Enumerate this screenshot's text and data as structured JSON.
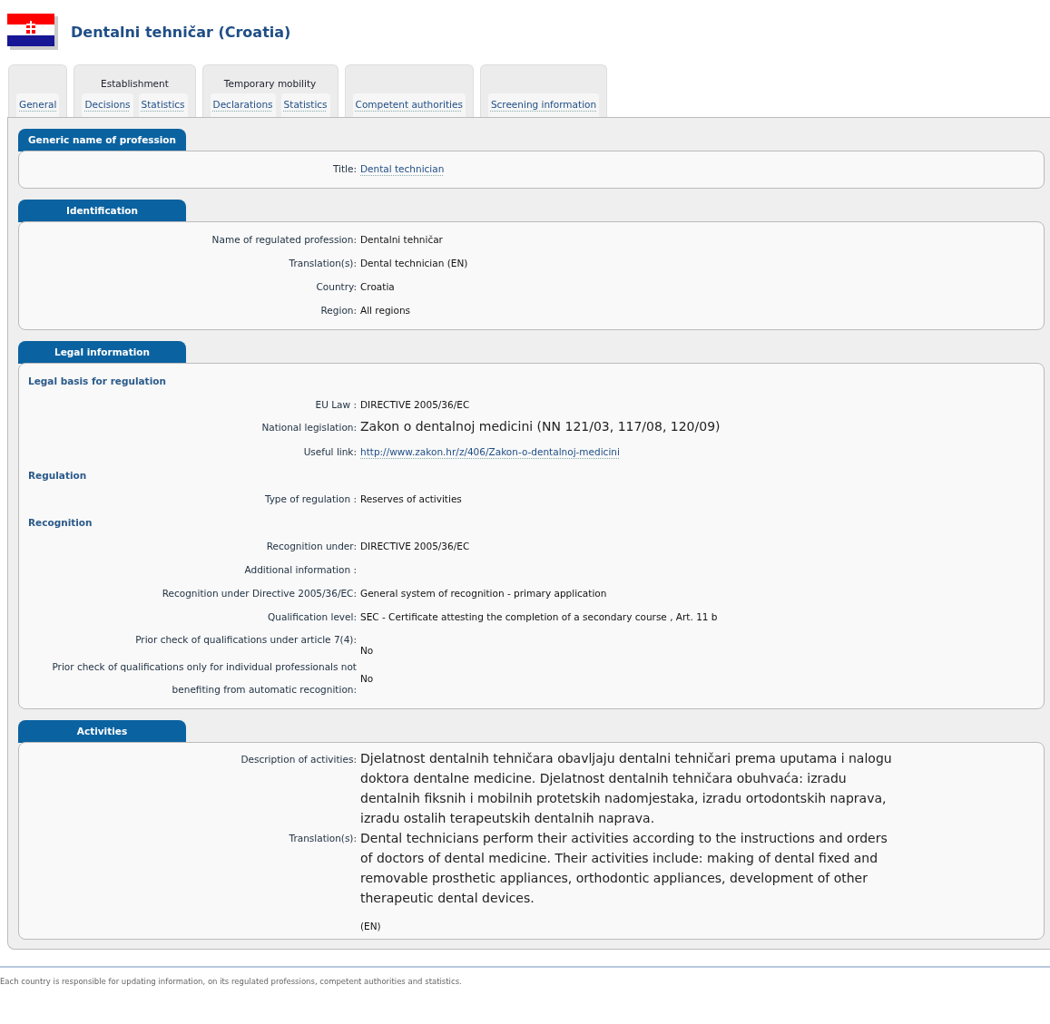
{
  "header": {
    "title": "Dentalni tehničar (Croatia)"
  },
  "tab_groups": [
    {
      "tabs": [
        {
          "label": "General"
        }
      ]
    },
    {
      "title": "Establishment",
      "tabs": [
        {
          "label": "Decisions"
        },
        {
          "label": "Statistics"
        }
      ]
    },
    {
      "title": "Temporary mobility",
      "tabs": [
        {
          "label": "Declarations"
        },
        {
          "label": "Statistics"
        }
      ]
    },
    {
      "tabs": [
        {
          "label": "Competent authorities"
        }
      ]
    },
    {
      "tabs": [
        {
          "label": "Screening information"
        }
      ]
    }
  ],
  "sections": [
    {
      "title": "Generic name of profession",
      "items": [
        {
          "kind": "link",
          "label": "Title:",
          "value": "Dental technician"
        }
      ]
    },
    {
      "title": "Identification",
      "items": [
        {
          "kind": "text",
          "label": "Name of regulated profession:",
          "value": "Dentalni tehničar"
        },
        {
          "kind": "text",
          "label": "Translation(s):",
          "value": "Dental technician (EN)"
        },
        {
          "kind": "text",
          "label": "Country:",
          "value": "Croatia"
        },
        {
          "kind": "text",
          "label": "Region:",
          "value": "All regions"
        }
      ]
    },
    {
      "title": "Legal information",
      "items": [
        {
          "kind": "heading",
          "label": "Legal basis for regulation"
        },
        {
          "kind": "text",
          "label": "EU Law :",
          "value": "DIRECTIVE 2005/36/EC"
        },
        {
          "kind": "large",
          "label": "National legislation:",
          "value": "Zakon o dentalnoj medicini (NN 121/03, 117/08, 120/09)"
        },
        {
          "kind": "link",
          "label": "Useful link:",
          "value": "http://www.zakon.hr/z/406/Zakon-o-dentalnoj-medicini"
        },
        {
          "kind": "heading",
          "label": "Regulation"
        },
        {
          "kind": "text",
          "label": "Type of regulation :",
          "value": "Reserves of activities"
        },
        {
          "kind": "heading",
          "label": "Recognition"
        },
        {
          "kind": "text",
          "label": "Recognition under:",
          "value": "DIRECTIVE 2005/36/EC"
        },
        {
          "kind": "text",
          "label": "Additional information :"
        },
        {
          "kind": "text",
          "label": "Recognition under Directive 2005/36/EC:",
          "value": "General system of recognition - primary application"
        },
        {
          "kind": "text",
          "label": "Qualification level:",
          "value": "SEC - Certificate attesting the completion of a secondary course , Art. 11 b"
        },
        {
          "kind": "below",
          "label": "Prior check of qualifications under article 7(4):",
          "value": "No"
        },
        {
          "kind": "text",
          "label": "Prior check of qualifications only for individual professionals not benefiting from automatic recognition:",
          "value": "No"
        }
      ]
    },
    {
      "title": "Activities",
      "items": [
        {
          "kind": "large",
          "label": "Description of activities:",
          "value": "Djelatnost dentalnih tehničara obavljaju dentalni tehničari prema uputama i nalogu doktora dentalne medicine. Djelatnost dentalnih tehničara obuhvaća: izradu dentalnih fiksnih i mobilnih protetskih nadomjestaka, izradu ortodontskih naprava, izradu ostalih terapeutskih dentalnih naprava."
        },
        {
          "kind": "large",
          "label": "Translation(s):",
          "value": "Dental technicians perform their activities according to the instructions and orders of doctors of dental medicine. Their activities include: making of dental fixed and removable prosthetic appliances, orthodontic appliances, development of other therapeutic dental devices.",
          "note": "(EN)"
        }
      ]
    }
  ],
  "footer": {
    "text": "Each country is responsible for updating information, on its regulated professions, competent authorities and statistics."
  }
}
